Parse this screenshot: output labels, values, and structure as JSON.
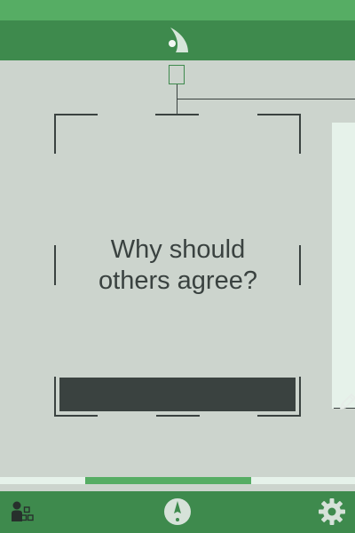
{
  "card": {
    "question_line1": "Why should",
    "question_line2": "others agree?"
  },
  "progress": {
    "fraction": 0.4675
  },
  "icons": {
    "logo": "sail-leaf-logo-icon",
    "edit": "pencil-icon",
    "left_nav": "people-graph-icon",
    "center_nav": "compass-icon",
    "right_nav": "gear-icon"
  },
  "colors": {
    "status_bar": "#56ad64",
    "header": "#3e8a4d",
    "background": "#ccd4cd",
    "card_panel": "#e6f2ea",
    "ink": "#3a4240"
  }
}
